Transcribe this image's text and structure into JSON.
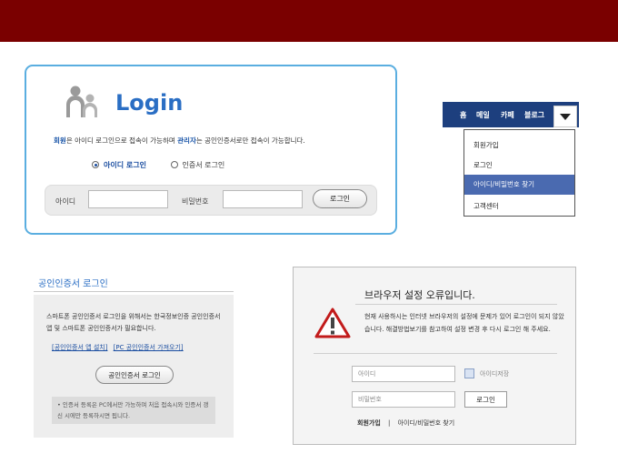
{
  "login": {
    "title": "Login",
    "desc_part1": "회원",
    "desc_part2": "은 아이디 로그인으로 접속이 가능하며 ",
    "desc_part3": "관리자",
    "desc_part4": "는 공인인증서로만 접속이 가능합니다.",
    "radio_id": "아이디 로그인",
    "radio_cert": "인증서 로그인",
    "radio_selected": "아이디 로그인",
    "id_label": "아이디",
    "pw_label": "비밀번호",
    "login_button": "로그인"
  },
  "nav": {
    "items": [
      "홈",
      "메일",
      "카페",
      "블로그"
    ],
    "dropdown": [
      "회원가입",
      "로그인",
      "아이디/비밀번호 찾기",
      "고객센터"
    ],
    "active_item": "아이디/비밀번호 찾기"
  },
  "cert": {
    "title": "공인인증서 로그인",
    "desc": "스마트폰 공인인증서 로그인을 위해서는 한국정보인증 공인인증서 앱 및 스마트폰 공인인증서가 필요합니다.",
    "link1": "[공인인증서 앱 설치]",
    "link2": "[PC 공인인증서 가져오기]",
    "button": "공인인증서 로그인",
    "note": "• 인증서 등록은 PC에서만 가능하며 처음 접속시와 인증서 갱신 시에만 등록하시면 됩니다."
  },
  "error": {
    "title": "브라우저 설정 오류입니다.",
    "text": "현재 사용하시는 인터넷 브라우저의 설정에 문제가 있어 로그인이 되지 않았습니다. 해결방법보기를 참고하여 설정 변경 후 다시 로그인 해 주세요.",
    "id_placeholder": "아이디",
    "pw_placeholder": "비밀번호",
    "save_id_label": "아이디저장",
    "login_button": "로그인",
    "footer_join": "회원가입",
    "footer_sep": "|",
    "footer_find": "아이디/비밀번호 찾기"
  },
  "colors": {
    "topbar": "#7a0000",
    "accent_blue": "#2a6ec4",
    "nav_bg": "#1d3f7e",
    "dropdown_active": "#4a6ab0"
  }
}
